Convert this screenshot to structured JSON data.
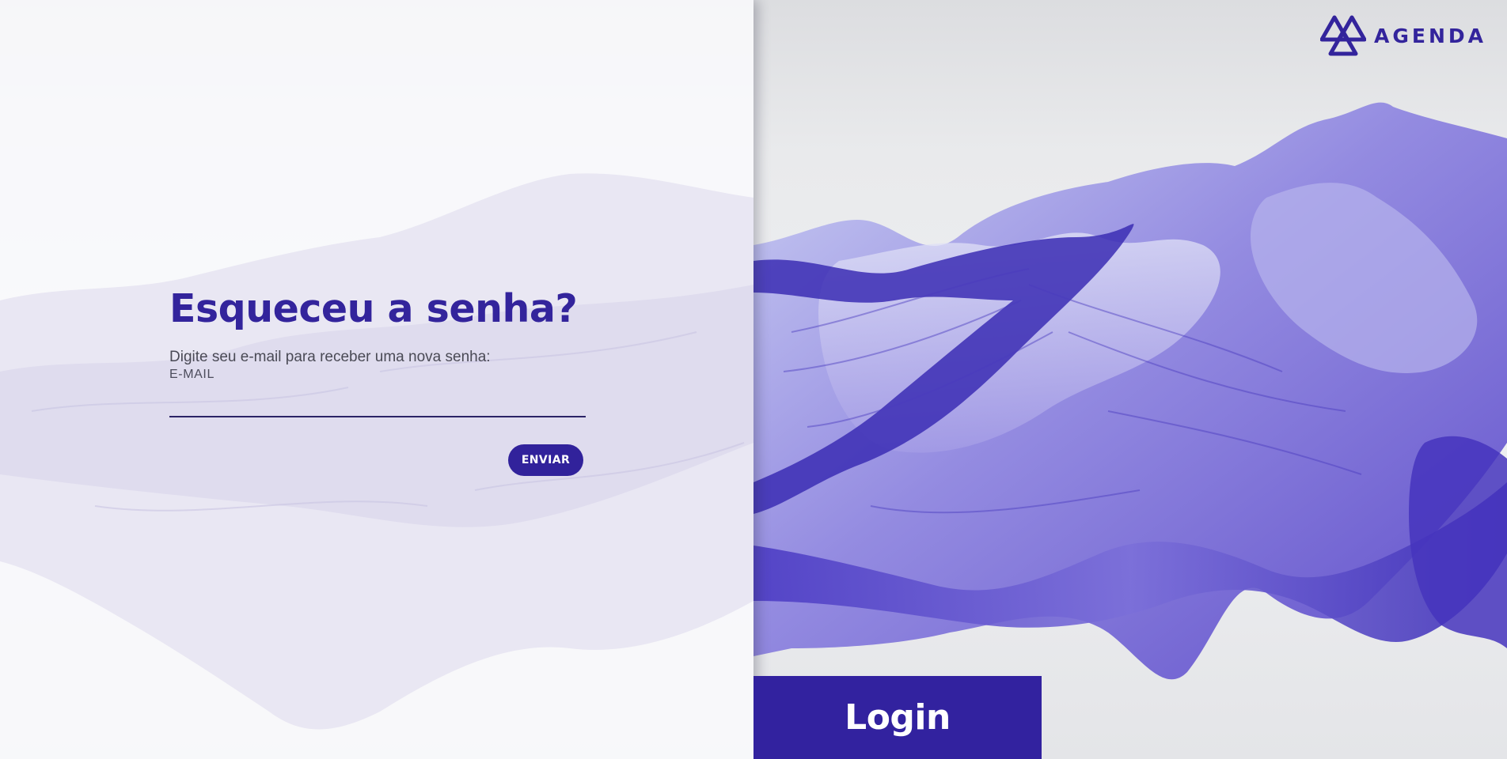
{
  "brand": {
    "name": "AGENDA",
    "color": "#33249c"
  },
  "forgot_password": {
    "title": "Esqueceu a senha?",
    "subtitle": "Digite seu e-mail para receber uma nova senha:",
    "email_label": "E-MAIL",
    "email_value": "",
    "email_placeholder": "",
    "send_label": "ENVIAR"
  },
  "login_tab": {
    "label": "Login"
  },
  "colors": {
    "accent": "#32229f",
    "panel_background": "#fafafd",
    "text_muted": "#4a4a55"
  }
}
